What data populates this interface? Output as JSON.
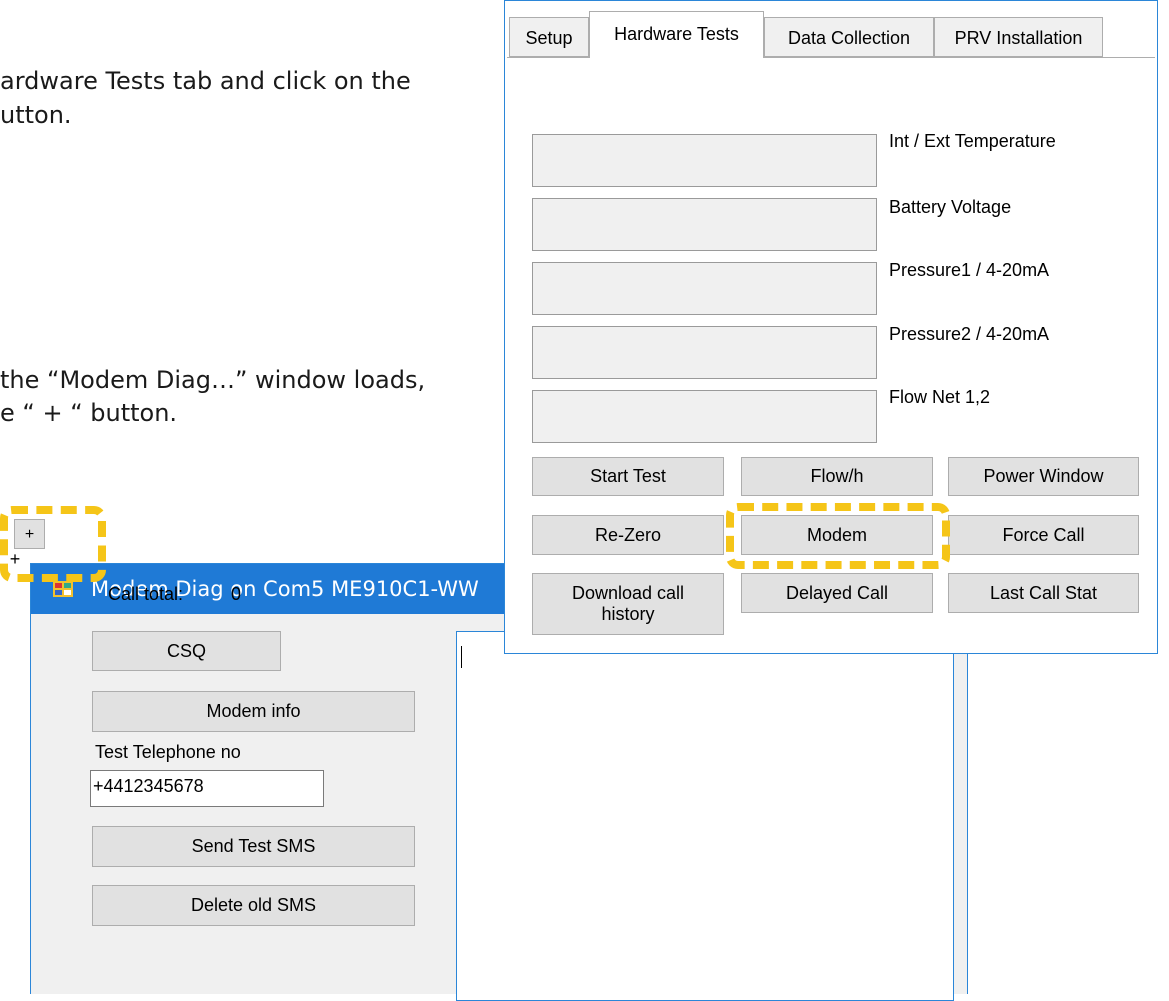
{
  "instructions": {
    "line1": "ardware Tests tab and click on the",
    "line2": "utton.",
    "line3": "the “Modem Diag…” window loads,",
    "line4": "e “ + “ button."
  },
  "modem_diag": {
    "title": "Modem Diag on Com5 ME910C1-WW",
    "plus_label": "+",
    "call_total_label": "Call total:",
    "call_total_value": "0",
    "csq_label": "CSQ",
    "modem_info_label": "Modem info",
    "test_phone_label": "Test Telephone no",
    "test_phone_value": "+4412345678",
    "send_sms_label": "Send Test SMS",
    "delete_sms_label": "Delete old SMS"
  },
  "panel": {
    "tabs": [
      "Setup",
      "Hardware Tests",
      "Data Collection",
      "PRV Installation"
    ],
    "active_tab": "Hardware Tests",
    "gauges": [
      "Int / Ext Temperature",
      "Battery Voltage",
      "Pressure1 / 4-20mA",
      "Pressure2 / 4-20mA",
      "Flow Net 1,2"
    ],
    "buttons": {
      "start_test": "Start Test",
      "flow_h": "Flow/h",
      "power_window": "Power Window",
      "re_zero": "Re-Zero",
      "modem": "Modem",
      "force_call": "Force Call",
      "download_history": "Download call history",
      "delayed_call": "Delayed Call",
      "last_call_stat": "Last Call Stat"
    }
  },
  "colors": {
    "highlight": "#f5c518",
    "titlebar": "#1f7ad6",
    "window_border": "#2b86d8"
  }
}
